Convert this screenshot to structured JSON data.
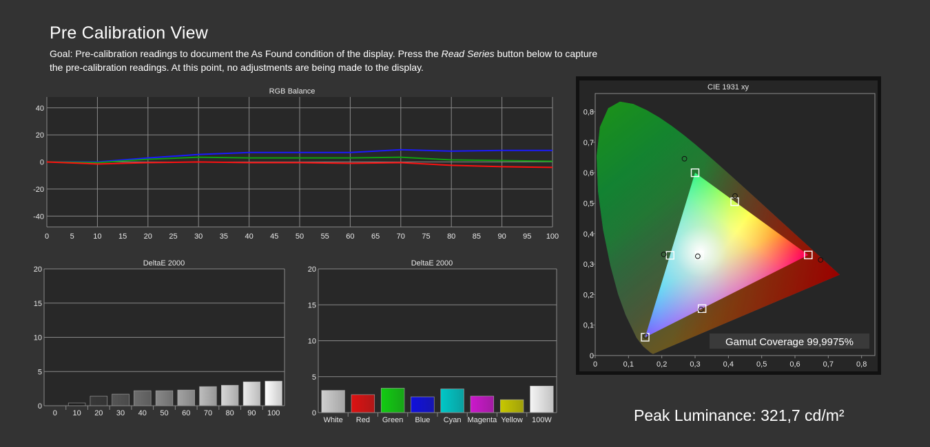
{
  "page": {
    "title": "Pre Calibration View",
    "goal_prefix": "Goal: Pre-calibration readings to document the As Found condition of the display. Press the ",
    "goal_emph": "Read Series",
    "goal_suffix": " button below to capture the pre-calibration readings. At this point, no adjustments are being made to the display.",
    "peak_luminance": "Peak Luminance: 321,7 cd/m²"
  },
  "colors": {
    "background": "#333333",
    "plot_bg": "#282828",
    "grid": "#8a8a8a",
    "red": "#ff1010",
    "green": "#10a010",
    "blue": "#1a1aff"
  },
  "chart_data": [
    {
      "id": "rgb-balance",
      "type": "line",
      "title": "RGB Balance",
      "x": [
        0,
        10,
        20,
        30,
        40,
        50,
        60,
        70,
        80,
        90,
        100
      ],
      "xticks": [
        0,
        5,
        10,
        15,
        20,
        25,
        30,
        35,
        40,
        45,
        50,
        55,
        60,
        65,
        70,
        75,
        80,
        85,
        90,
        95,
        100
      ],
      "xlim": [
        0,
        100
      ],
      "yticks": [
        40,
        20,
        0,
        -20,
        -40
      ],
      "ylim": [
        -48,
        48
      ],
      "grid": true,
      "series": [
        {
          "color": "#1a1aff",
          "values": [
            0,
            0,
            3,
            5.5,
            7,
            7,
            7,
            9,
            8,
            8.5,
            8.5
          ]
        },
        {
          "color": "#10a010",
          "values": [
            0,
            -0.5,
            2,
            3.5,
            3,
            3,
            3,
            3.5,
            1.5,
            1,
            0.5
          ]
        },
        {
          "color": "#ff1010",
          "values": [
            0,
            -1.5,
            -0.5,
            0,
            -0.5,
            -0.5,
            -1,
            -0.5,
            -2.5,
            -3.5,
            -4
          ]
        }
      ]
    },
    {
      "id": "deltae-grayscale",
      "type": "bar",
      "title": "DeltaE 2000",
      "categories": [
        "0",
        "10",
        "20",
        "30",
        "40",
        "50",
        "60",
        "70",
        "80",
        "90",
        "100"
      ],
      "values": [
        0,
        0.4,
        1.4,
        1.7,
        2.2,
        2.2,
        2.3,
        2.8,
        3.0,
        3.5,
        3.6
      ],
      "colors": [
        "#000000",
        "#1c1c1c",
        "#383838",
        "#555555",
        "#6e6e6e",
        "#888888",
        "#a3a3a3",
        "#bdbdbd",
        "#d6d6d6",
        "#ececec",
        "#ffffff"
      ],
      "yticks": [
        20,
        15,
        10,
        5,
        0
      ],
      "ylim": [
        0,
        20
      ],
      "grid": true
    },
    {
      "id": "deltae-colors",
      "type": "bar",
      "title": "DeltaE 2000",
      "categories": [
        "White",
        "Red",
        "Green",
        "Blue",
        "Cyan",
        "Magenta",
        "Yellow",
        "100W"
      ],
      "values": [
        3.1,
        2.5,
        3.4,
        2.2,
        3.3,
        2.3,
        1.8,
        3.7
      ],
      "colors": [
        "#cfcfcf",
        "#dd1212",
        "#12cc12",
        "#1010dd",
        "#00c8c8",
        "#cc18cc",
        "#c8c800",
        "#f5f5f5"
      ],
      "yticks": [
        20,
        15,
        10,
        5,
        0
      ],
      "ylim": [
        0,
        20
      ],
      "grid": true
    },
    {
      "id": "cie-1931",
      "type": "scatter",
      "title": "CIE 1931 xy",
      "xticks": [
        "0",
        "0,1",
        "0,2",
        "0,3",
        "0,4",
        "0,5",
        "0,6",
        "0,7",
        "0,8"
      ],
      "yticks": [
        "0,8",
        "0,7",
        "0,6",
        "0,5",
        "0,4",
        "0,3",
        "0,2",
        "0,1",
        "0"
      ],
      "xlim": [
        0,
        0.84
      ],
      "ylim": [
        0,
        0.86
      ],
      "gamut_triangle": {
        "red": [
          0.64,
          0.33
        ],
        "green": [
          0.3,
          0.6
        ],
        "blue": [
          0.15,
          0.06
        ]
      },
      "targets": [
        {
          "name": "red",
          "x": 0.64,
          "y": 0.33
        },
        {
          "name": "green",
          "x": 0.3,
          "y": 0.6
        },
        {
          "name": "blue",
          "x": 0.15,
          "y": 0.06
        },
        {
          "name": "cyan",
          "x": 0.225,
          "y": 0.329
        },
        {
          "name": "magenta",
          "x": 0.321,
          "y": 0.154
        },
        {
          "name": "yellow",
          "x": 0.419,
          "y": 0.505
        },
        {
          "name": "white",
          "x": 0.3127,
          "y": 0.329
        }
      ],
      "measured": [
        {
          "name": "red",
          "x": 0.677,
          "y": 0.314
        },
        {
          "name": "green",
          "x": 0.268,
          "y": 0.646
        },
        {
          "name": "blue",
          "x": 0.152,
          "y": 0.064
        },
        {
          "name": "cyan",
          "x": 0.206,
          "y": 0.332
        },
        {
          "name": "magenta",
          "x": 0.318,
          "y": 0.151
        },
        {
          "name": "yellow",
          "x": 0.42,
          "y": 0.524
        },
        {
          "name": "white",
          "x": 0.308,
          "y": 0.326
        }
      ],
      "annotation": "Gamut Coverage 99,9975%"
    }
  ]
}
